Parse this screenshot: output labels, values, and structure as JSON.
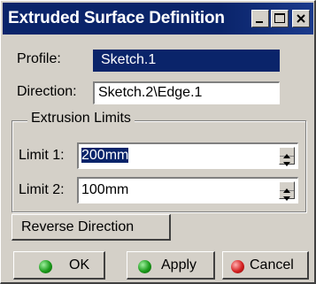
{
  "window": {
    "title": "Extruded Surface Definition"
  },
  "form": {
    "profile_label": "Profile:",
    "profile_value": "Sketch.1",
    "direction_label": "Direction:",
    "direction_value": "Sketch.2\\Edge.1"
  },
  "extrusion_limits": {
    "group_label": "Extrusion Limits",
    "limit1_label": "Limit 1:",
    "limit1_value": "200mm",
    "limit2_label": "Limit 2:",
    "limit2_value": "100mm"
  },
  "buttons": {
    "reverse_label": "Reverse Direction",
    "ok_label": "OK",
    "apply_label": "Apply",
    "cancel_label": "Cancel"
  },
  "colors": {
    "title_bar": "#0a246a",
    "selection": "#0a246a",
    "ok_icon": "#1a9a1a",
    "apply_icon": "#1a9a1a",
    "cancel_icon": "#d42020"
  },
  "icons": {
    "minimize": "minimize-icon",
    "maximize": "maximize-icon",
    "close": "close-icon",
    "spinner_up": "arrow-up-icon",
    "spinner_down": "arrow-down-icon",
    "ok": "green-ball-icon",
    "apply": "green-ball-icon",
    "cancel": "red-ball-icon"
  }
}
